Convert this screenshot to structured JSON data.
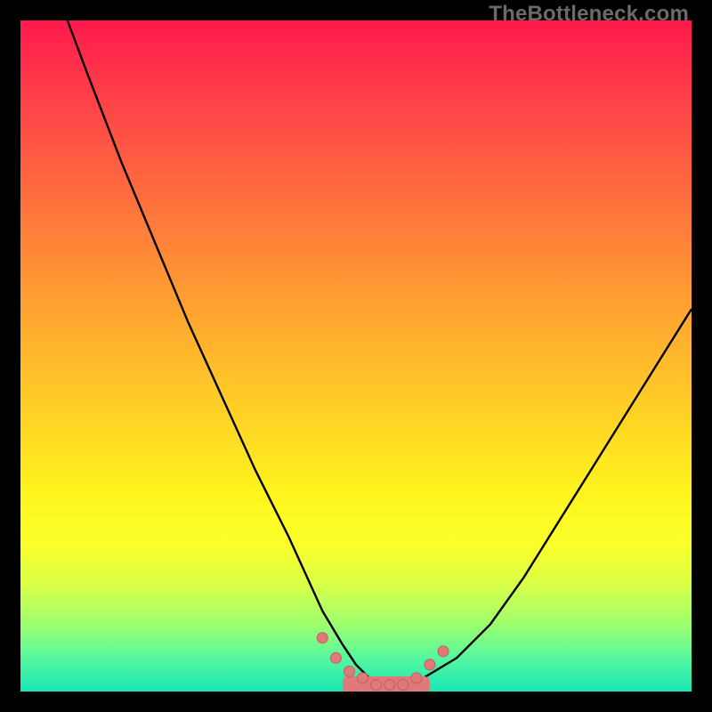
{
  "watermark": "TheBottleneck.com",
  "colors": {
    "frame": "#000000",
    "curve": "#000000",
    "marker_fill": "#e07a7a",
    "marker_stroke": "#c85a5a",
    "highlight_band": "#e07a7a"
  },
  "chart_data": {
    "type": "line",
    "title": "",
    "xlabel": "",
    "ylabel": "",
    "xlim": [
      0,
      100
    ],
    "ylim": [
      0,
      100
    ],
    "series": [
      {
        "name": "bottleneck-curve",
        "x": [
          7,
          10,
          15,
          20,
          25,
          30,
          35,
          40,
          45,
          48,
          50,
          52,
          54,
          56,
          58,
          60,
          65,
          70,
          75,
          80,
          85,
          90,
          95,
          100
        ],
        "y": [
          100,
          92,
          79,
          67,
          55,
          44,
          33,
          23,
          12,
          7,
          4,
          2,
          1,
          1,
          1,
          2,
          5,
          10,
          17,
          25,
          33,
          41,
          49,
          57
        ]
      }
    ],
    "markers": {
      "name": "highlighted-points",
      "x": [
        45,
        47,
        49,
        51,
        53,
        55,
        57,
        59,
        61,
        63
      ],
      "y": [
        8,
        5,
        3,
        2,
        1,
        1,
        1,
        2,
        4,
        6
      ]
    },
    "highlight_band": {
      "x_start": 48,
      "x_end": 61,
      "y": 1,
      "thickness": 2.5
    },
    "grid": false,
    "legend": false
  }
}
